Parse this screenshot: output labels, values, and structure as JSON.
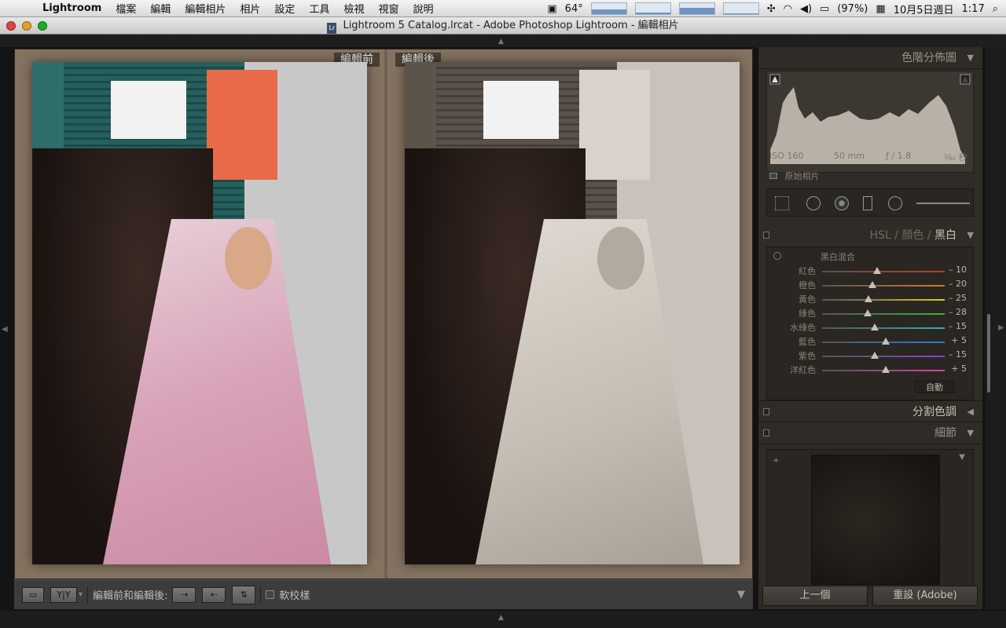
{
  "menubar": {
    "app": "Lightroom",
    "items": [
      "檔案",
      "編輯",
      "編輯相片",
      "相片",
      "設定",
      "工具",
      "檢視",
      "視窗",
      "說明"
    ],
    "temperature": "64°",
    "battery": "(97%)",
    "datetime": "10月5日週日",
    "time": "1:17"
  },
  "window": {
    "title": "Lightroom 5 Catalog.lrcat - Adobe Photoshop Lightroom - 編輯相片",
    "doc_icon": "Lr"
  },
  "viewer": {
    "before_label": "編輯前",
    "after_label": "編輯後"
  },
  "toolbar": {
    "view_mode_label": "Y|Y",
    "compare_label": "編輯前和編輯後:",
    "softproof_label": "軟校樣"
  },
  "histogram": {
    "title": "色階分佈圖",
    "iso": "ISO 160",
    "focal": "50 mm",
    "aperture": "ƒ / 1.8",
    "shutter": "¹⁄₈₀ 秒",
    "original_label": "原始相片"
  },
  "hsl": {
    "tab_hsl": "HSL",
    "sep1": "/",
    "tab_color": "顏色",
    "sep2": "/",
    "tab_bw": "黑白",
    "panel_title": "黑白混合",
    "sliders": [
      {
        "label": "紅色",
        "value": "– 10",
        "level": 0.45,
        "color": "#c0392b"
      },
      {
        "label": "橙色",
        "value": "– 20",
        "level": 0.41,
        "color": "#d9782b"
      },
      {
        "label": "黃色",
        "value": "– 25",
        "level": 0.38,
        "color": "#d9c82b"
      },
      {
        "label": "綠色",
        "value": "– 28",
        "level": 0.37,
        "color": "#3fae3f"
      },
      {
        "label": "水綠色",
        "value": "– 15",
        "level": 0.43,
        "color": "#2bb3a8"
      },
      {
        "label": "藍色",
        "value": "+ 5",
        "level": 0.52,
        "color": "#2b78d9"
      },
      {
        "label": "紫色",
        "value": "– 15",
        "level": 0.43,
        "color": "#8a3fd9"
      },
      {
        "label": "洋紅色",
        "value": "+ 5",
        "level": 0.52,
        "color": "#d93fae"
      }
    ],
    "auto_label": "自動"
  },
  "split_toning": {
    "title": "分割色調"
  },
  "detail": {
    "title": "細節"
  },
  "buttons": {
    "previous": "上一個",
    "reset": "重設 (Adobe)"
  }
}
